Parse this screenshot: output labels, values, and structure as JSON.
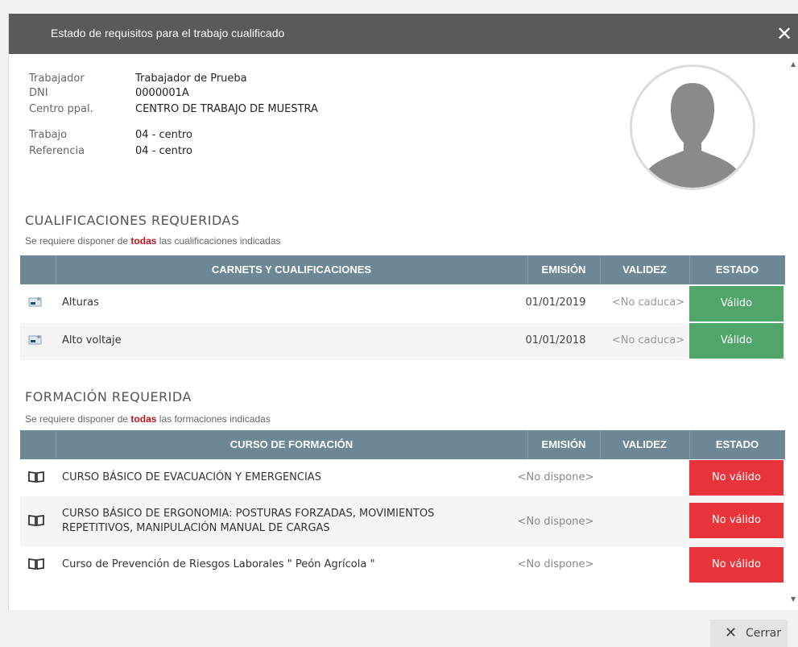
{
  "modal": {
    "title": "Estado de requisitos para el trabajo cualificado",
    "close_icon": "close-icon"
  },
  "worker": {
    "fields": [
      {
        "label": "Trabajador",
        "value": "Trabajador de Prueba"
      },
      {
        "label": "DNI",
        "value": "0000001A"
      },
      {
        "label": "Centro ppal.",
        "value": "CENTRO DE TRABAJO DE MUESTRA"
      },
      {
        "label": "Trabajo",
        "value": "04 - centro"
      },
      {
        "label": "Referencia",
        "value": "04 - centro"
      }
    ],
    "avatar_icon": "user-silhouette-icon"
  },
  "qualifications": {
    "title": "CUALIFICACIONES REQUERIDAS",
    "note_prefix": "Se requiere disponer de ",
    "note_emph": "todas",
    "note_suffix": " las cualificaciones indicadas",
    "headers": {
      "name": "CARNETS Y CUALIFICACIONES",
      "emission": "EMISIÓN",
      "validity": "VALIDEZ",
      "status": "ESTADO"
    },
    "row_icon": "id-card-icon",
    "rows": [
      {
        "name": "Alturas",
        "emission": "01/01/2019",
        "validity": "<No caduca>",
        "status": "Válido"
      },
      {
        "name": "Alto voltaje",
        "emission": "01/01/2018",
        "validity": "<No caduca>",
        "status": "Válido"
      }
    ]
  },
  "training": {
    "title": "FORMACIÓN REQUERIDA",
    "note_prefix": "Se requiere disponer de ",
    "note_emph": "todas",
    "note_suffix": " las formaciones indicadas",
    "headers": {
      "name": "CURSO DE FORMACIÓN",
      "emission": "EMISIÓN",
      "validity": "VALIDEZ",
      "status": "ESTADO"
    },
    "row_icon": "book-icon",
    "rows": [
      {
        "name_line1": "CURSO BÁSICO DE EVACUACIÓN Y EMERGENCIAS",
        "name_line2": "",
        "emission": "<No dispone>",
        "validity": "",
        "status": "No válido"
      },
      {
        "name_line1": "CURSO BÁSICO DE ERGONOMIA: POSTURAS FORZADAS, MOVIMIENTOS",
        "name_line2": "REPETITIVOS, MANIPULACIÓN MANUAL DE CARGAS",
        "emission": "<No dispone>",
        "validity": "",
        "status": "No válido"
      },
      {
        "name_line1": "Curso de Prevención de Riesgos Laborales \" Peón Agrícola \"",
        "name_line2": "",
        "emission": "<No dispone>",
        "validity": "",
        "status": "No válido"
      }
    ]
  },
  "footer": {
    "close_label": "Cerrar",
    "close_icon": "close-icon"
  },
  "colors": {
    "header_bg": "#5a5a5a",
    "table_header": "#6e8794",
    "valid": "#52a56a",
    "invalid": "#e8343a",
    "emphasis": "#c0141b"
  }
}
